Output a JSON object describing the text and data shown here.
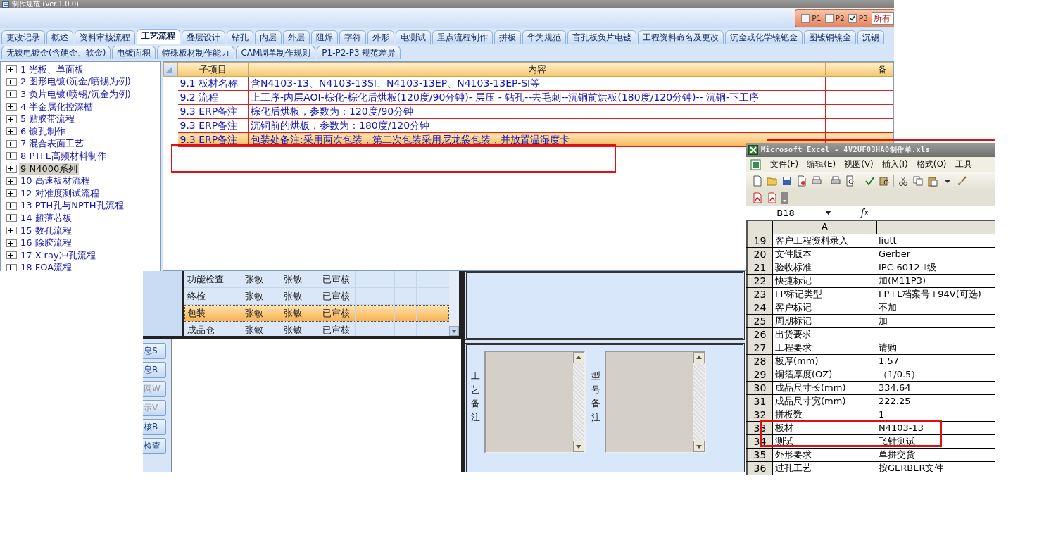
{
  "app": {
    "title": "制作规范 (Ver.1.0.0)",
    "filters": [
      {
        "label": "P1",
        "checked": false
      },
      {
        "label": "P2",
        "checked": false
      },
      {
        "label": "P3",
        "checked": true
      }
    ],
    "filter_field": {
      "value": "所有"
    },
    "tabs_row_1": [
      {
        "label": "更改记录",
        "selected": false
      },
      {
        "label": "概述",
        "selected": false
      },
      {
        "label": "资料审核流程",
        "selected": false
      },
      {
        "label": "工艺流程",
        "selected": true
      },
      {
        "label": "叠层设计",
        "selected": false
      },
      {
        "label": "钻孔",
        "selected": false
      },
      {
        "label": "内层",
        "selected": false
      },
      {
        "label": "外层",
        "selected": false
      },
      {
        "label": "阻焊",
        "selected": false
      },
      {
        "label": "字符",
        "selected": false
      },
      {
        "label": "外形",
        "selected": false
      },
      {
        "label": "电测试",
        "selected": false
      },
      {
        "label": "重点流程制作",
        "selected": false
      },
      {
        "label": "拼板",
        "selected": false
      },
      {
        "label": "华为规范",
        "selected": false
      },
      {
        "label": "盲孔板负片电镀",
        "selected": false
      },
      {
        "label": "工程资料命名及更改",
        "selected": false
      },
      {
        "label": "沉金或化学镍钯金",
        "selected": false
      },
      {
        "label": "图镀铜镍金",
        "selected": false
      },
      {
        "label": "沉锡",
        "selected": false
      }
    ],
    "tabs_row_2": [
      {
        "label": "无镍电镀金(含硬金、软金)",
        "selected": false
      },
      {
        "label": "电镀面积",
        "selected": false
      },
      {
        "label": "特殊板材制作能力",
        "selected": false
      },
      {
        "label": "CAM调单制作规则",
        "selected": false
      },
      {
        "label": "P1-P2-P3 规范差异",
        "selected": false
      }
    ],
    "tree": [
      {
        "label": "1 光板、单面板",
        "expanded": false,
        "selected": false
      },
      {
        "label": "2 图形电镀(沉金/喷锡为例)",
        "expanded": false,
        "selected": false
      },
      {
        "label": "3 负片电镀(喷锡/沉金为例)",
        "expanded": false,
        "selected": false
      },
      {
        "label": "4 半金属化控深槽",
        "expanded": false,
        "selected": false
      },
      {
        "label": "5 贴胶带流程",
        "expanded": false,
        "selected": false
      },
      {
        "label": "6 镀孔制作",
        "expanded": false,
        "selected": false
      },
      {
        "label": "7 混合表面工艺",
        "expanded": false,
        "selected": false
      },
      {
        "label": "8 PTFE高频材料制作",
        "expanded": false,
        "selected": false
      },
      {
        "label": "9 N4000系列",
        "expanded": false,
        "selected": true
      },
      {
        "label": "10 高速板材流程",
        "expanded": false,
        "selected": false
      },
      {
        "label": "12 对准度测试流程",
        "expanded": false,
        "selected": false
      },
      {
        "label": "13 PTH孔与NPTH孔流程",
        "expanded": false,
        "selected": false
      },
      {
        "label": "14 超薄芯板",
        "expanded": false,
        "selected": false
      },
      {
        "label": "15 数孔流程",
        "expanded": false,
        "selected": false
      },
      {
        "label": "16 除胶流程",
        "expanded": false,
        "selected": false
      },
      {
        "label": "17 X-ray冲孔流程",
        "expanded": false,
        "selected": false
      },
      {
        "label": "18 FOA流程",
        "expanded": false,
        "selected": false
      }
    ],
    "spec_table": {
      "columns": [
        "子项目",
        "内容",
        "备"
      ],
      "rows": [
        {
          "item": "9.1 板材名称",
          "content": "含N4103-13、N4103-13SI、N4103-13EP、N4103-13EP-SI等",
          "selected": false
        },
        {
          "item": "9.2 流程",
          "content": "上工序-内层AOI-棕化-棕化后烘板(120度/90分钟)- 层压 - 钻孔--去毛刺--沉铜前烘板(180度/120分钟)-- 沉铜-下工序",
          "selected": false
        },
        {
          "item": "9.3 ERP备注",
          "content": "棕化后烘板，参数为：120度/90分钟",
          "selected": false
        },
        {
          "item": "9.3 ERP备注",
          "content": "沉铜前的烘板，参数为：180度/120分钟",
          "selected": false
        },
        {
          "item": "9.3 ERP备注",
          "content": "包装处备注:采用两次包装，第二次包装采用尼龙袋包装，并放置温湿度卡",
          "selected": true
        }
      ]
    }
  },
  "approval_table": {
    "rows": [
      {
        "cells": [
          "功能检查",
          "张敏",
          "张敏",
          "已审核"
        ],
        "selected": false
      },
      {
        "cells": [
          "终检",
          "张敏",
          "张敏",
          "已审核"
        ],
        "selected": false
      },
      {
        "cells": [
          "包装",
          "张敏",
          "张敏",
          "已审核"
        ],
        "selected": true
      },
      {
        "cells": [
          "成品仓",
          "张敏",
          "张敏",
          "已审核"
        ],
        "selected": false
      }
    ]
  },
  "side_buttons": [
    {
      "label": "息S",
      "disabled": false
    },
    {
      "label": "息R",
      "disabled": false
    },
    {
      "label": "网W",
      "disabled": true
    },
    {
      "label": "示V",
      "disabled": true
    },
    {
      "label": "核B",
      "disabled": false
    },
    {
      "label": "检查",
      "disabled": false
    }
  ],
  "remarks": [
    {
      "label": "工艺备注"
    },
    {
      "label": "型号备注"
    }
  ],
  "excel": {
    "title": "Microsoft Excel - 4V2UF03HA0制作单.xls",
    "menu": [
      "文件(F)",
      "编辑(E)",
      "视图(V)",
      "插入(I)",
      "格式(O)",
      "工具"
    ],
    "name_box": "B18",
    "formula_label": "fx",
    "column_header": "A",
    "rows": [
      {
        "number": "19",
        "label": "客户工程资料录入",
        "value": "liutt"
      },
      {
        "number": "20",
        "label": "文件版本",
        "value": "Gerber"
      },
      {
        "number": "21",
        "label": "验收标准",
        "value": "IPC-6012 Ⅱ级"
      },
      {
        "number": "22",
        "label": "快捷标记",
        "value": "加(M11P3)"
      },
      {
        "number": "23",
        "label": "FP标记类型",
        "value": "FP+E档案号+94V(可选)"
      },
      {
        "number": "24",
        "label": "客户标记",
        "value": "不加"
      },
      {
        "number": "25",
        "label": "周期标记",
        "value": "加"
      },
      {
        "number": "26",
        "label": "出货要求"
      },
      {
        "number": "27",
        "label": "工程要求",
        "value": "请购"
      },
      {
        "number": "28",
        "label": "板厚(mm)",
        "value": "1.57"
      },
      {
        "number": "29",
        "label": "铜箔厚度(OZ)",
        "value": "（1/0.5）"
      },
      {
        "number": "30",
        "label": "成品尺寸长(mm)",
        "value": "334.64"
      },
      {
        "number": "31",
        "label": "成品尺寸宽(mm)",
        "value": "222.25"
      },
      {
        "number": "32",
        "label": "拼板数",
        "value": "1"
      },
      {
        "number": "33",
        "label": "板材",
        "value": "N4103-13"
      },
      {
        "number": "34",
        "label": "测试",
        "value": "飞针测试"
      },
      {
        "number": "35",
        "label": "外形要求",
        "value": "单拼交货"
      },
      {
        "number": "36",
        "label": "过孔工艺",
        "value": "按GERBER文件"
      }
    ]
  }
}
